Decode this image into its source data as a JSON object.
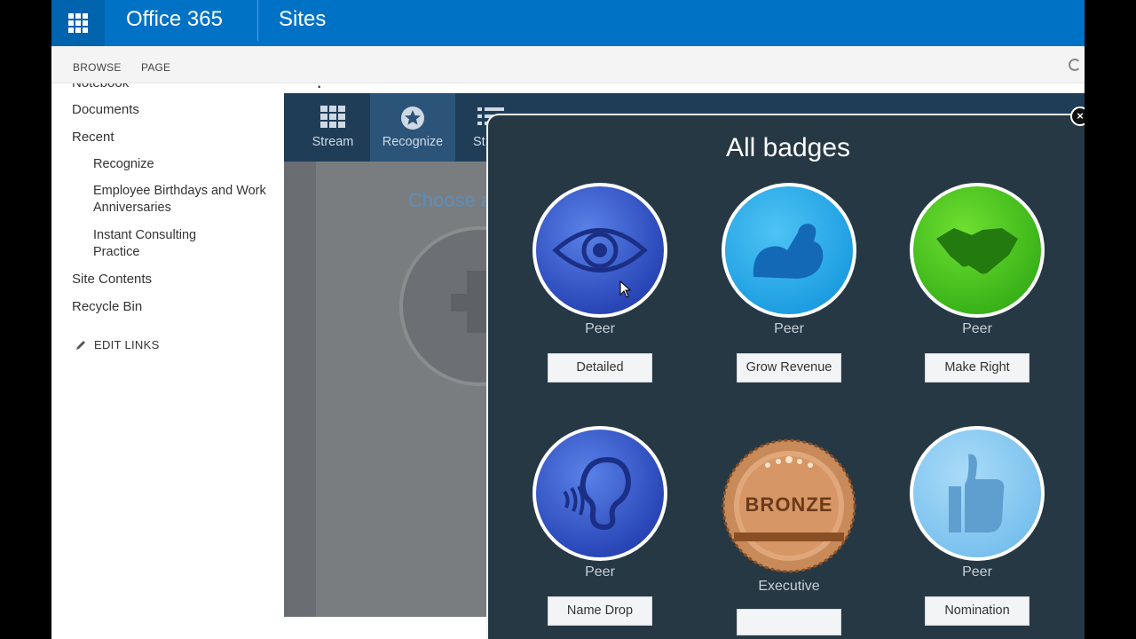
{
  "suitebar": {
    "brand": "Office 365",
    "app": "Sites"
  },
  "ribbon": {
    "tabs": [
      "BROWSE",
      "PAGE"
    ]
  },
  "quicklaunch": {
    "items": [
      {
        "label": "Notebook",
        "level": 1
      },
      {
        "label": "Documents",
        "level": 1
      },
      {
        "label": "Recent",
        "level": 1
      },
      {
        "label": "Recognize",
        "level": 2
      },
      {
        "label": "Employee Birthdays and Work Anniversaries",
        "level": 2
      },
      {
        "label": "Instant Consulting Practice",
        "level": 2
      },
      {
        "label": "Site Contents",
        "level": 1
      },
      {
        "label": "Recycle Bin",
        "level": 1
      }
    ],
    "edit_links": "EDIT LINKS"
  },
  "app": {
    "nav": [
      {
        "label": "Stream",
        "icon": "grid-icon",
        "active": false
      },
      {
        "label": "Recognize",
        "icon": "star-icon",
        "active": true
      },
      {
        "label": "St",
        "icon": "list-icon",
        "active": false
      }
    ],
    "backdrop_heading": "Choose a"
  },
  "modal": {
    "title": "All badges",
    "close": "×",
    "badges": [
      {
        "category": "Peer",
        "name": "Detailed",
        "icon": "eye-icon",
        "color": "#2a47b8"
      },
      {
        "category": "Peer",
        "name": "Grow Revenue",
        "icon": "flexed-arm-icon",
        "color": "#1f9fe2"
      },
      {
        "category": "Peer",
        "name": "Make Right",
        "icon": "handshake-icon",
        "color": "#3bb41a"
      },
      {
        "category": "Peer",
        "name": "Name Drop",
        "icon": "ear-icon",
        "color": "#2a47b8"
      },
      {
        "category": "Executive",
        "name": "",
        "icon": "bronze-medal-icon",
        "color": "#c98a5a",
        "medal_text": "BRONZE"
      },
      {
        "category": "Peer",
        "name": "Nomination",
        "icon": "thumbs-up-icon",
        "color": "#7cc2ef"
      }
    ]
  }
}
